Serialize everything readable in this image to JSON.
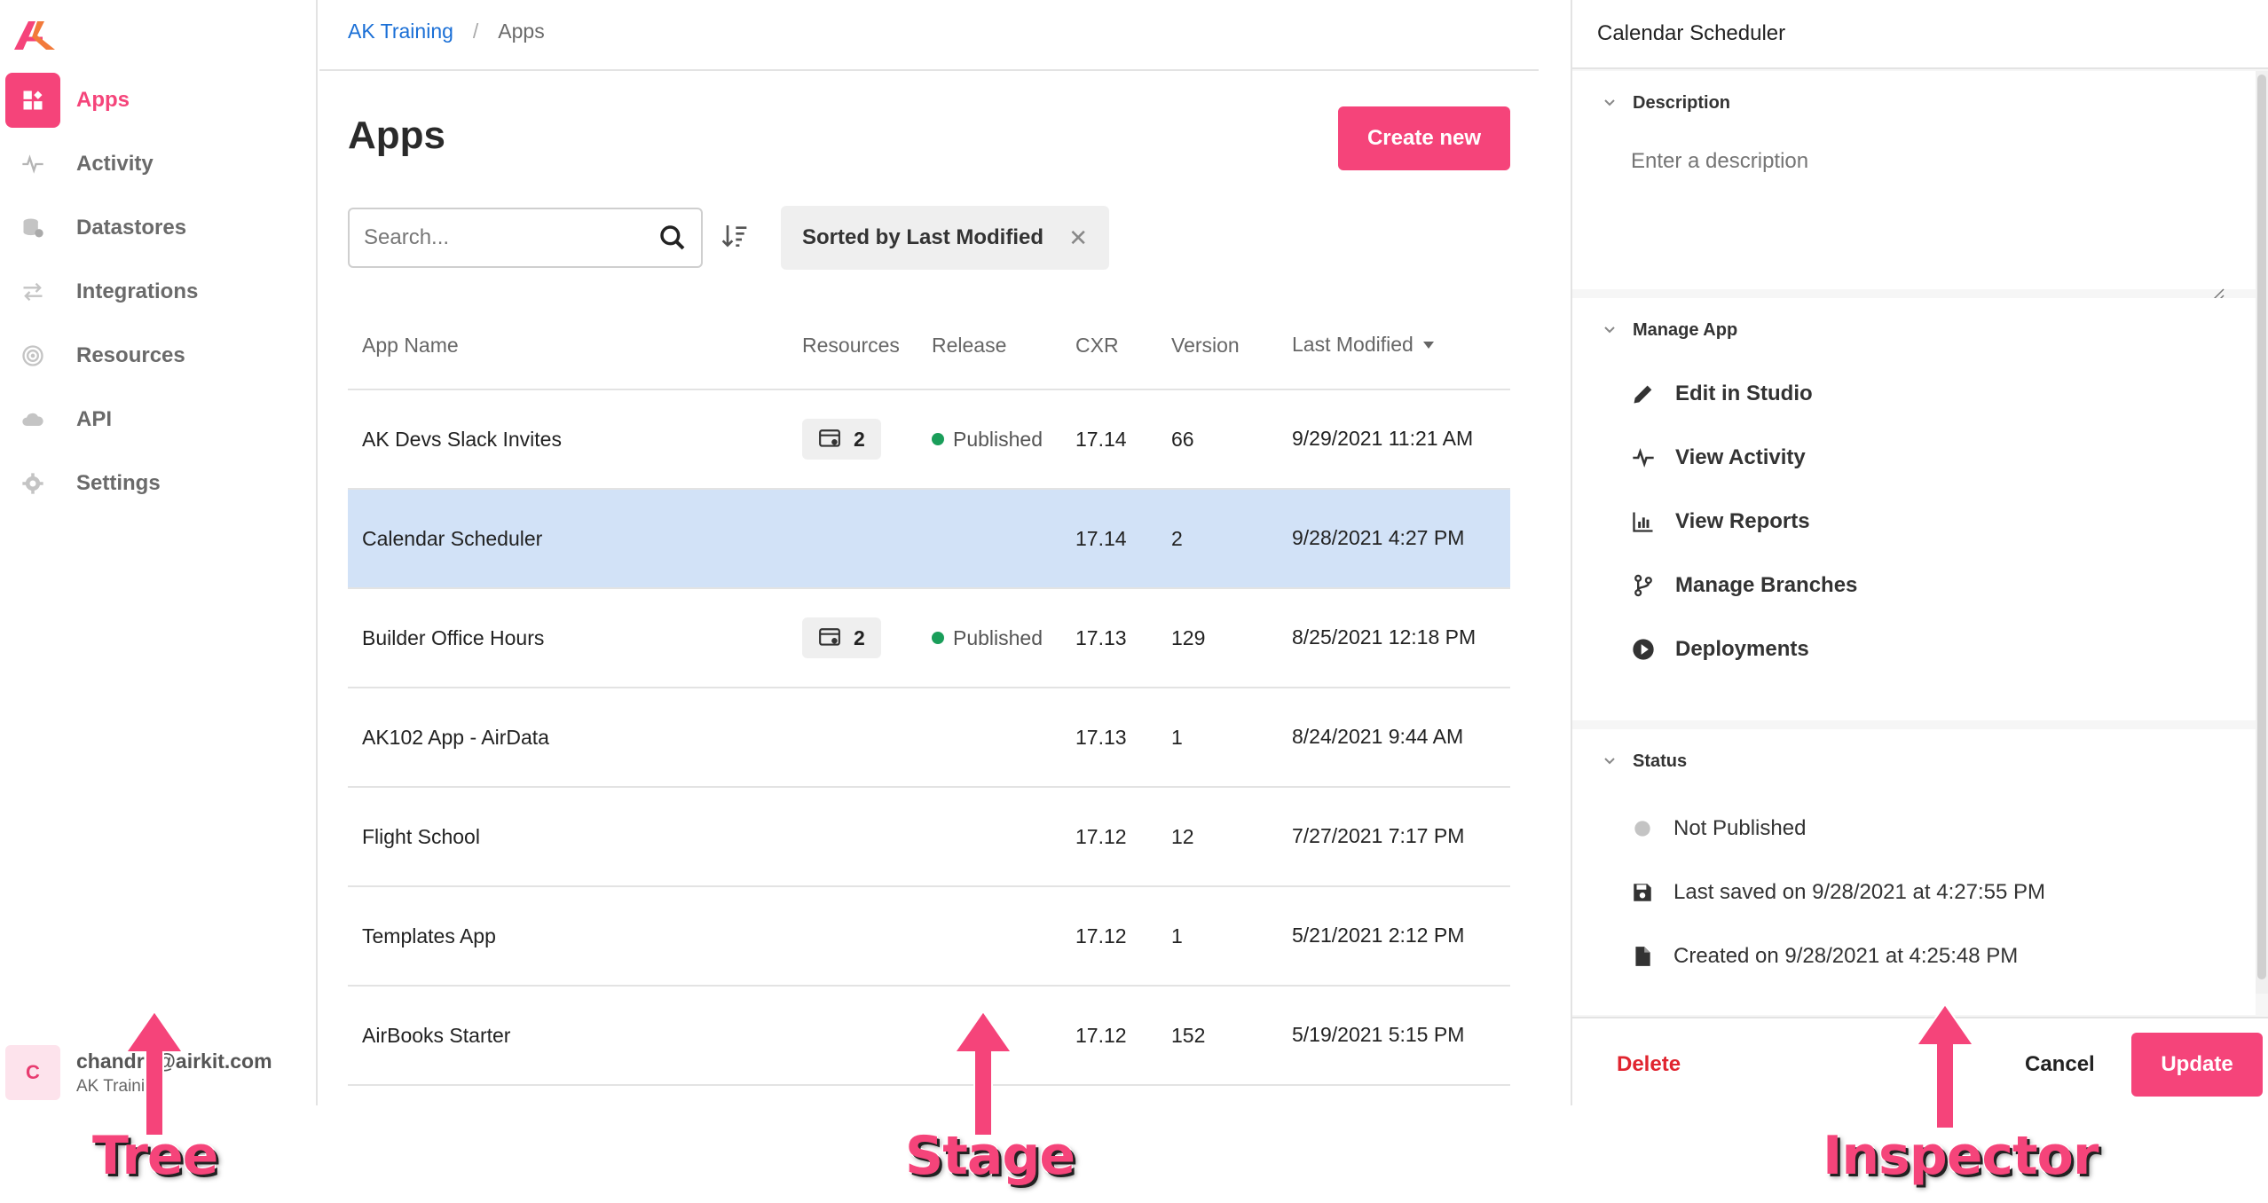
{
  "sidebar": {
    "items": [
      {
        "label": "Apps",
        "icon": "apps-icon",
        "active": true
      },
      {
        "label": "Activity",
        "icon": "activity-icon"
      },
      {
        "label": "Datastores",
        "icon": "datastores-icon"
      },
      {
        "label": "Integrations",
        "icon": "integrations-icon"
      },
      {
        "label": "Resources",
        "icon": "resources-icon"
      },
      {
        "label": "API",
        "icon": "cloud-icon"
      },
      {
        "label": "Settings",
        "icon": "gear-icon"
      }
    ],
    "user": {
      "initial": "C",
      "email": "chandra@airkit.com",
      "org": "AK Training"
    }
  },
  "stage": {
    "breadcrumb": {
      "link": "AK Training",
      "separator": "/",
      "current": "Apps"
    },
    "title": "Apps",
    "create_label": "Create new",
    "search": {
      "placeholder": "Search...",
      "value": ""
    },
    "sort_chip": "Sorted by Last Modified",
    "columns": {
      "name": "App Name",
      "resources": "Resources",
      "release": "Release",
      "cxr": "CXR",
      "version": "Version",
      "modified": "Last Modified"
    },
    "rows": [
      {
        "name": "AK Devs Slack Invites",
        "resources": "2",
        "release": "Published",
        "cxr": "17.14",
        "version": "66",
        "modified": "9/29/2021 11:21 AM"
      },
      {
        "name": "Calendar Scheduler",
        "resources": "",
        "release": "",
        "cxr": "17.14",
        "version": "2",
        "modified": "9/28/2021 4:27 PM",
        "selected": true
      },
      {
        "name": "Builder Office Hours",
        "resources": "2",
        "release": "Published",
        "cxr": "17.13",
        "version": "129",
        "modified": "8/25/2021 12:18 PM"
      },
      {
        "name": "AK102 App - AirData",
        "resources": "",
        "release": "",
        "cxr": "17.13",
        "version": "1",
        "modified": "8/24/2021 9:44 AM"
      },
      {
        "name": "Flight School",
        "resources": "",
        "release": "",
        "cxr": "17.12",
        "version": "12",
        "modified": "7/27/2021 7:17 PM"
      },
      {
        "name": "Templates App",
        "resources": "",
        "release": "",
        "cxr": "17.12",
        "version": "1",
        "modified": "5/21/2021 2:12 PM"
      },
      {
        "name": "AirBooks Starter",
        "resources": "",
        "release": "",
        "cxr": "17.12",
        "version": "152",
        "modified": "5/19/2021 5:15 PM"
      }
    ],
    "published_color": "#1a9e5a",
    "selected_color": "#d2e2f7"
  },
  "inspector": {
    "title": "Calendar Scheduler",
    "description": {
      "heading": "Description",
      "placeholder": "Enter a description",
      "value": ""
    },
    "manage": {
      "heading": "Manage App",
      "items": [
        {
          "label": "Edit in Studio",
          "icon": "pencil-icon"
        },
        {
          "label": "View Activity",
          "icon": "activity-icon"
        },
        {
          "label": "View Reports",
          "icon": "reports-icon"
        },
        {
          "label": "Manage Branches",
          "icon": "branch-icon"
        },
        {
          "label": "Deployments",
          "icon": "play-circle-icon"
        }
      ]
    },
    "status": {
      "heading": "Status",
      "items": [
        {
          "label": "Not Published",
          "icon": "status-dot-icon"
        },
        {
          "label": "Last saved on 9/28/2021 at 4:27:55 PM",
          "icon": "save-icon"
        },
        {
          "label": "Created on 9/28/2021 at 4:25:48 PM",
          "icon": "file-icon"
        }
      ]
    },
    "footer": {
      "delete": "Delete",
      "cancel": "Cancel",
      "update": "Update"
    }
  },
  "annotations": {
    "tree": "Tree",
    "stage": "Stage",
    "inspector": "Inspector"
  },
  "colors": {
    "accent": "#f5447a",
    "link": "#1a6fd6",
    "danger": "#e0242f"
  }
}
